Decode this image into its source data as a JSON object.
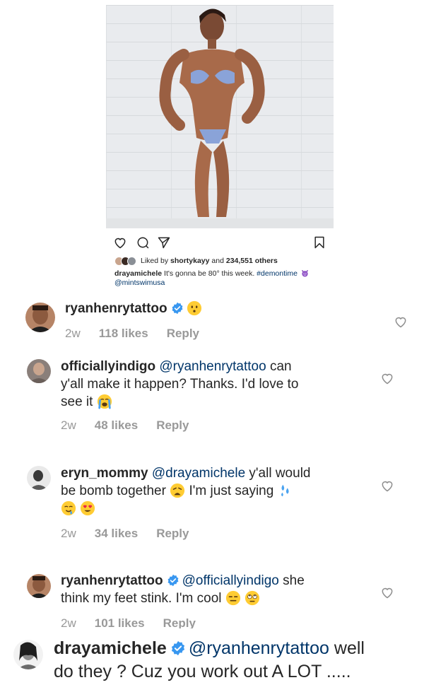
{
  "post": {
    "likes_by_user": "shortykayy",
    "likes_count": "234,551",
    "liked_by_prefix": "Liked by",
    "liked_by_and": "and",
    "liked_by_others": "others",
    "caption_user": "drayamichele",
    "caption_text": "It's gonna be 80° this week.",
    "caption_hashtag": "#demontime",
    "caption_mention": "@mintswimusa"
  },
  "comments": [
    {
      "user": "ryanhenrytattoo",
      "mention": "",
      "text": "",
      "time": "2w",
      "likes": "118 likes",
      "reply": "Reply"
    },
    {
      "user": "officiallyindigo",
      "mention": "@ryanhenrytattoo",
      "text_line1": "can",
      "text_line2": "y'all make it happen? Thanks. I'd love to",
      "text_line3": "see it",
      "time": "2w",
      "likes": "48 likes",
      "reply": "Reply"
    },
    {
      "user": "eryn_mommy",
      "mention": "@drayamichele",
      "text_line1": "y'all would",
      "text_line2a": "be bomb together",
      "text_line2b": "I'm just saying",
      "time": "2w",
      "likes": "34 likes",
      "reply": "Reply"
    },
    {
      "user": "ryanhenrytattoo",
      "mention": "@officiallyindigo",
      "text_line1": "she",
      "text_line2": "think my feet stink. I'm cool",
      "time": "2w",
      "likes": "101 likes",
      "reply": "Reply"
    },
    {
      "user": "drayamichele",
      "mention": "@ryanhenrytattoo",
      "text_line1": "well",
      "text_line2": "do they ? Cuz you work out A LOT ....."
    }
  ],
  "icons": {
    "like": "heart-outline-icon",
    "comment": "comment-bubble-icon",
    "share": "paper-plane-icon",
    "save": "bookmark-icon",
    "verified": "verified-badge-icon"
  },
  "colors": {
    "text": "#262626",
    "mention": "#003569",
    "meta": "#999999",
    "verified": "#3897f0"
  }
}
